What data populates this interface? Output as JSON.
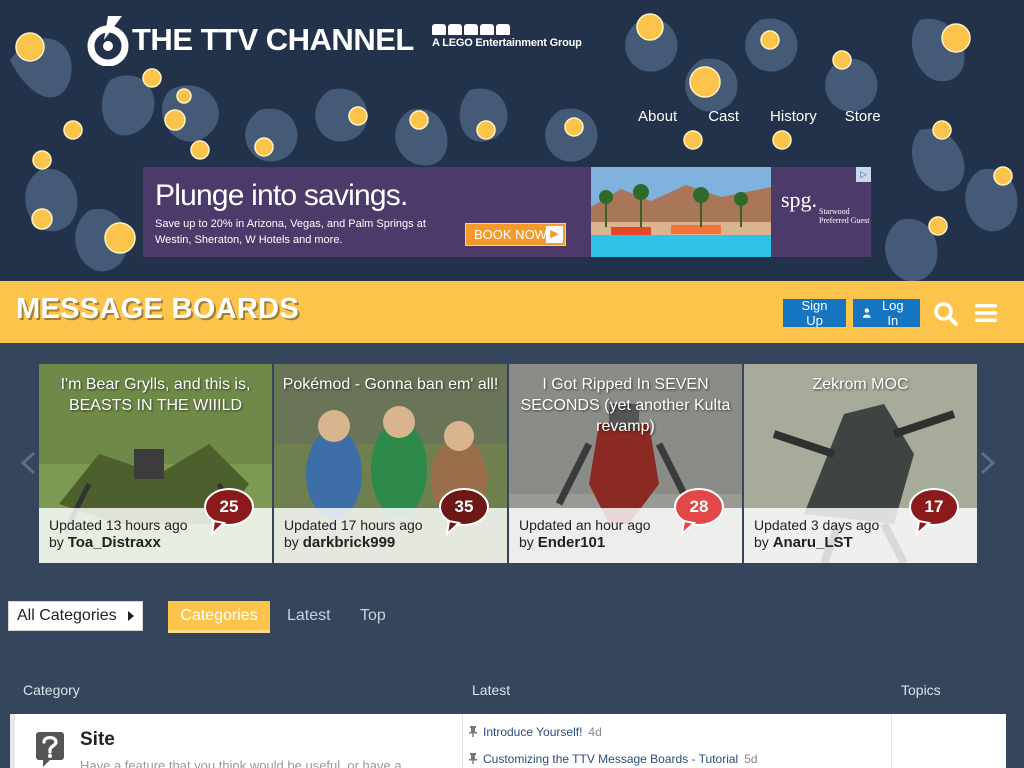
{
  "header": {
    "logo_text": "THE TTV CHANNEL",
    "sub_brand": "A LEGO Entertainment Group",
    "nav": [
      {
        "label": "About"
      },
      {
        "label": "Cast"
      },
      {
        "label": "History"
      },
      {
        "label": "Store"
      }
    ]
  },
  "ad": {
    "headline": "Plunge into savings.",
    "body": "Save up to 20% in Arizona, Vegas, and Palm Springs at Westin, Sheraton, W Hotels and more.",
    "cta": "BOOK NOW",
    "brand": "spg.",
    "brand_sub": "Starwood Preferred Guest"
  },
  "title_bar": {
    "title": "MESSAGE BOARDS",
    "signup_label": "Sign Up",
    "login_label": "Log In"
  },
  "featured": [
    {
      "title": "I'm Bear Grylls, and this is, BEASTS IN THE WIIILD",
      "updated": "Updated 13 hours ago",
      "by": "by",
      "author": "Toa_Distraxx",
      "replies": "25",
      "bubble_color": "#8b1b1b"
    },
    {
      "title": "Pokémod - Gonna ban em' all!",
      "updated": "Updated 17 hours ago",
      "by": "by",
      "author": "darkbrick999",
      "replies": "35",
      "bubble_color": "#6e1717"
    },
    {
      "title": "I Got Ripped In SEVEN SECONDS (yet another Kulta revamp)",
      "updated": "Updated an hour ago",
      "by": "by",
      "author": "Ender101",
      "replies": "28",
      "bubble_color": "#e24848"
    },
    {
      "title": "Zekrom MOC",
      "updated": "Updated 3 days ago",
      "by": "by",
      "author": "Anaru_LST",
      "replies": "17",
      "bubble_color": "#8b1b1b"
    }
  ],
  "category_nav": {
    "dropdown": "All Categories",
    "tabs": [
      "Categories",
      "Latest",
      "Top"
    ]
  },
  "table": {
    "headers": [
      "Category",
      "Latest",
      "Topics"
    ],
    "rows": [
      {
        "name": "Site",
        "description": "Have a feature that you think would be useful, or have a",
        "topics": [
          {
            "title": "Introduce Yourself!",
            "age": "4d"
          },
          {
            "title": "Customizing the TTV Message Boards - Tutorial",
            "age": "5d"
          }
        ]
      }
    ]
  },
  "colors": {
    "header_bg": "#22324a",
    "accent_yellow": "#fdc44c",
    "button_blue": "#1675c0",
    "page_bg": "#34455c"
  }
}
